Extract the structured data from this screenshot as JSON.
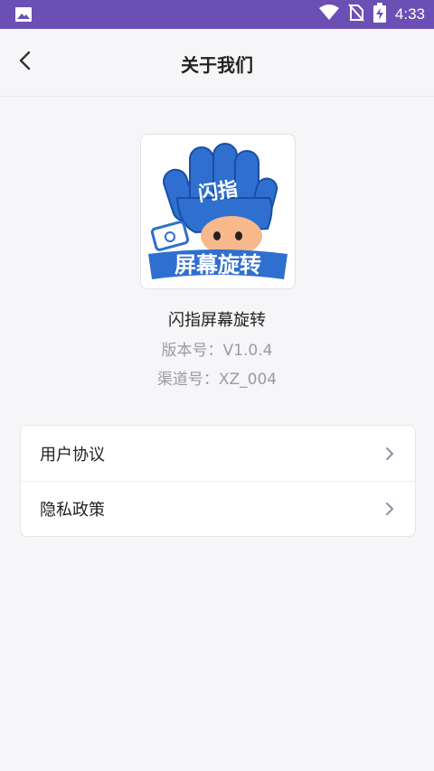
{
  "status_bar": {
    "time": "4:33",
    "icons": [
      "image-icon",
      "wifi-icon",
      "no-sim-icon",
      "battery-charging-icon"
    ]
  },
  "header": {
    "title": "关于我们",
    "back_icon": "chevron-left-icon"
  },
  "app": {
    "logo_text_top": "闪指",
    "logo_text_bottom": "屏幕旋转",
    "name": "闪指屏幕旋转",
    "version": "版本号：V1.0.4",
    "channel": "渠道号：XZ_004"
  },
  "menu": {
    "items": [
      {
        "label": "用户协议",
        "icon": "chevron-right-icon"
      },
      {
        "label": "隐私政策",
        "icon": "chevron-right-icon"
      }
    ]
  },
  "colors": {
    "status_bar": "#6c4fb5",
    "background": "#f6f6f8",
    "logo_blue": "#2f6fd0"
  }
}
